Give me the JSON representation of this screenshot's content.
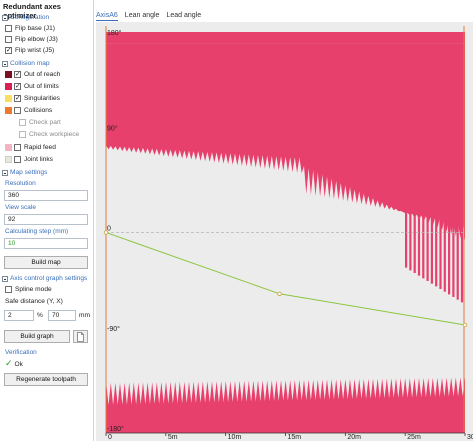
{
  "app": {
    "title": "Redundant axes optimizer"
  },
  "configuration": {
    "header": "Configuration",
    "items": [
      {
        "label": "Flip base (J1)",
        "checked": false
      },
      {
        "label": "Flip elbow (J3)",
        "checked": false
      },
      {
        "label": "Flip wrist (J5)",
        "checked": true
      }
    ]
  },
  "collision_map": {
    "header": "Collision map",
    "items": [
      {
        "label": "Out of reach",
        "checked": true,
        "color": "#7a0f24"
      },
      {
        "label": "Out of limits",
        "checked": true,
        "color": "#d91f54"
      },
      {
        "label": "Singularities",
        "checked": true,
        "color": "#f5e060"
      },
      {
        "label": "Collisions",
        "checked": false,
        "color": "#ef7a2e"
      }
    ],
    "sub_items": [
      {
        "label": "Check part",
        "checked": false
      },
      {
        "label": "Check workpiece",
        "checked": false
      }
    ],
    "extra_items": [
      {
        "label": "Rapid feed",
        "checked": false,
        "color": "#f2b3c4"
      },
      {
        "label": "Joint links",
        "checked": false,
        "color": "#e8e8e0"
      }
    ]
  },
  "map_settings": {
    "header": "Map settings",
    "resolution_label": "Resolution",
    "resolution_value": "360",
    "view_scale_label": "View scale",
    "view_scale_value": "92",
    "calc_step_label": "Calculating step (mm)",
    "calc_step_value": "10",
    "build_map_label": "Build map"
  },
  "axis_control": {
    "header": "Axis control graph settings",
    "spline_label": "Spline mode",
    "spline_checked": false,
    "safe_distance_label": "Safe distance (Y, X)",
    "safe_y_value": "2",
    "safe_y_unit": "%",
    "safe_x_value": "70",
    "safe_x_unit": "mm",
    "build_graph_label": "Build graph"
  },
  "verification": {
    "label": "Verification",
    "status": "Ok",
    "status_color": "#2e9b2e",
    "regenerate_label": "Regenerate toolpath"
  },
  "tabs": [
    {
      "label": "AxisA6",
      "active": true
    },
    {
      "label": "Lean angle",
      "active": false
    },
    {
      "label": "Lead angle",
      "active": false
    }
  ],
  "chart_data": {
    "type": "line",
    "y_ticks": [
      "180°",
      "90°",
      "0",
      "-90°",
      "-180°"
    ],
    "x_ticks": [
      "0",
      "5m",
      "10m",
      "15m",
      "20m",
      "25m",
      "30m"
    ],
    "ylim": [
      -180,
      180
    ],
    "xlim": [
      0,
      30
    ],
    "series": [
      {
        "points": [
          [
            0,
            0
          ],
          [
            14.5,
            -55
          ],
          [
            30,
            -83
          ]
        ],
        "color": "#8cc63f"
      }
    ],
    "colors": {
      "background": "#ececec",
      "limits": "#e8406c",
      "out_of_reach": "#7a0f24",
      "zero_line": "#b5b5b5",
      "axis_line": "#e07a3c"
    }
  }
}
